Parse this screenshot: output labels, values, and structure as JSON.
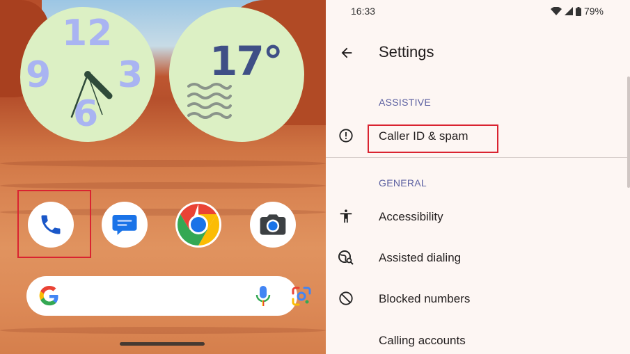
{
  "home": {
    "clock": {
      "num_12": "12",
      "num_9": "9",
      "num_3": "3",
      "num_6": "6"
    },
    "weather": {
      "temperature": "17°"
    },
    "apps": [
      {
        "name": "Phone",
        "icon": "phone-icon"
      },
      {
        "name": "Messages",
        "icon": "messages-icon"
      },
      {
        "name": "Chrome",
        "icon": "chrome-icon"
      },
      {
        "name": "Camera",
        "icon": "camera-icon"
      }
    ],
    "search": {
      "google_letter": "G",
      "mic_icon": "mic-icon",
      "lens_icon": "lens-icon"
    }
  },
  "status_bar": {
    "time": "16:33",
    "battery": "79%"
  },
  "settings": {
    "title": "Settings",
    "sections": [
      {
        "header": "ASSISTIVE",
        "items": [
          {
            "label": "Caller ID & spam",
            "icon": "alert-circle-icon"
          }
        ]
      },
      {
        "header": "GENERAL",
        "items": [
          {
            "label": "Accessibility",
            "icon": "accessibility-icon"
          },
          {
            "label": "Assisted dialing",
            "icon": "globe-search-icon"
          },
          {
            "label": "Blocked numbers",
            "icon": "block-icon"
          },
          {
            "label": "Calling accounts",
            "icon": ""
          }
        ]
      }
    ]
  },
  "colors": {
    "accent_blue": "#1a73e8",
    "highlight_red": "#d92330",
    "section_header": "#5a5fa0",
    "widget_green": "#dcf0c4"
  }
}
